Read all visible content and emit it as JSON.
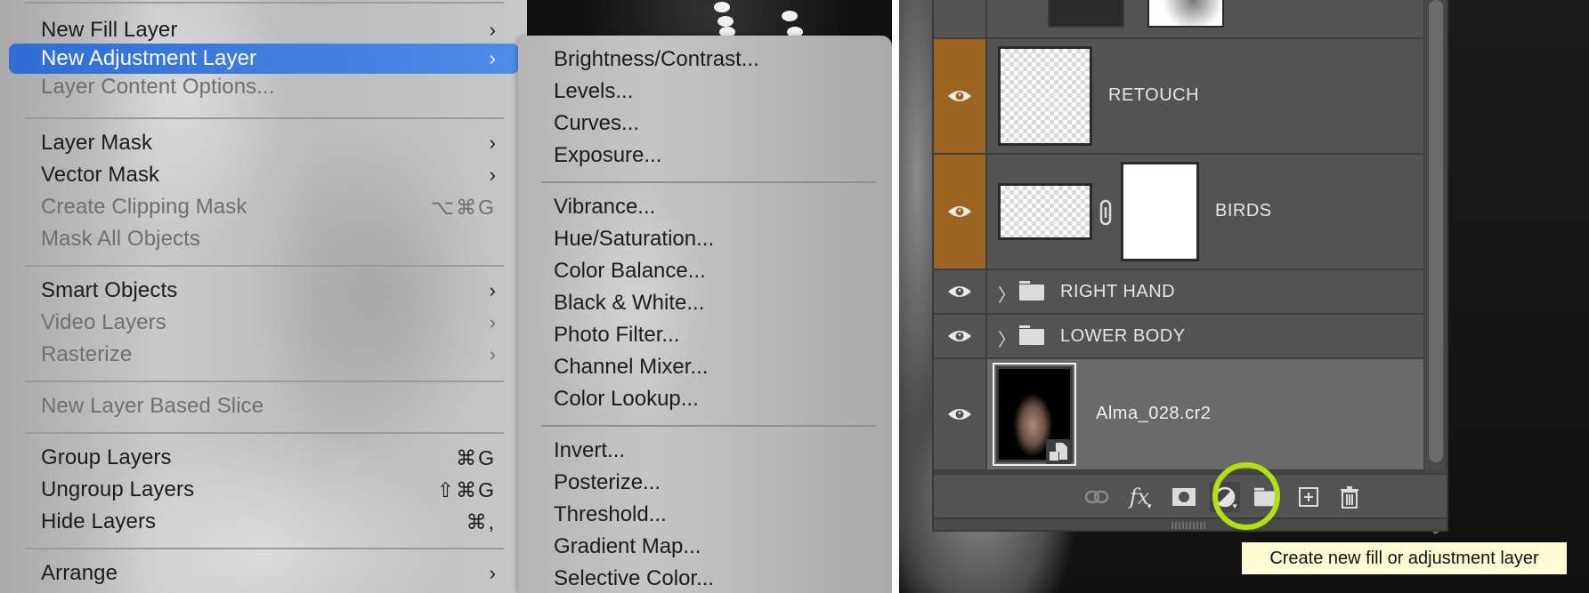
{
  "layer_menu": {
    "items": [
      {
        "label": "New Fill Layer",
        "state": "enabled",
        "submenu": true,
        "shortcut": ""
      },
      {
        "label": "New Adjustment Layer",
        "state": "highlighted",
        "submenu": true,
        "shortcut": ""
      },
      {
        "label": "Layer Content Options...",
        "state": "disabled",
        "submenu": false,
        "shortcut": ""
      },
      {
        "label": "Layer Mask",
        "state": "enabled",
        "submenu": true,
        "shortcut": ""
      },
      {
        "label": "Vector Mask",
        "state": "enabled",
        "submenu": true,
        "shortcut": ""
      },
      {
        "label": "Create Clipping Mask",
        "state": "disabled",
        "submenu": false,
        "shortcut": "⌥⌘G"
      },
      {
        "label": "Mask All Objects",
        "state": "disabled",
        "submenu": false,
        "shortcut": ""
      },
      {
        "label": "Smart Objects",
        "state": "enabled",
        "submenu": true,
        "shortcut": ""
      },
      {
        "label": "Video Layers",
        "state": "disabled",
        "submenu": true,
        "shortcut": ""
      },
      {
        "label": "Rasterize",
        "state": "disabled",
        "submenu": true,
        "shortcut": ""
      },
      {
        "label": "New Layer Based Slice",
        "state": "disabled",
        "submenu": false,
        "shortcut": ""
      },
      {
        "label": "Group Layers",
        "state": "enabled",
        "submenu": false,
        "shortcut": "⌘G"
      },
      {
        "label": "Ungroup Layers",
        "state": "enabled",
        "submenu": false,
        "shortcut": "⇧⌘G"
      },
      {
        "label": "Hide Layers",
        "state": "enabled",
        "submenu": false,
        "shortcut": "⌘,"
      },
      {
        "label": "Arrange",
        "state": "enabled",
        "submenu": true,
        "shortcut": ""
      }
    ],
    "chevron": "›"
  },
  "adjustment_submenu": {
    "items": [
      "Brightness/Contrast...",
      "Levels...",
      "Curves...",
      "Exposure...",
      "Vibrance...",
      "Hue/Saturation...",
      "Color Balance...",
      "Black & White...",
      "Photo Filter...",
      "Channel Mixer...",
      "Color Lookup...",
      "Invert...",
      "Posterize...",
      "Threshold...",
      "Gradient Map...",
      "Selective Color..."
    ]
  },
  "layers_panel": {
    "layers": [
      {
        "name": "RETOUCH",
        "type": "pixel",
        "visible": true,
        "color_label": "orange"
      },
      {
        "name": "BIRDS",
        "type": "pixel-with-mask",
        "visible": true,
        "color_label": "orange",
        "mask_linked": true
      },
      {
        "name": "RIGHT HAND",
        "type": "group",
        "visible": true,
        "expanded": false
      },
      {
        "name": "LOWER BODY",
        "type": "group",
        "visible": true,
        "expanded": false
      },
      {
        "name": "Alma_028.cr2",
        "type": "smart-object",
        "visible": true,
        "selected": true
      }
    ],
    "footer_buttons": [
      {
        "name": "link-layers",
        "icon": "link-icon"
      },
      {
        "name": "add-layer-style",
        "icon": "fx-icon",
        "text": "fx"
      },
      {
        "name": "add-layer-mask",
        "icon": "mask-icon"
      },
      {
        "name": "create-fill-adjustment-layer",
        "icon": "adjustment-icon",
        "active": true
      },
      {
        "name": "create-group",
        "icon": "folder-icon"
      },
      {
        "name": "create-new-layer",
        "icon": "new-layer-icon"
      },
      {
        "name": "delete-layer",
        "icon": "trash-icon"
      }
    ],
    "tooltip": "Create new fill or adjustment layer"
  },
  "colors": {
    "menu_highlight": "#3a78e0",
    "layer_color_label": "#9c6421",
    "annotation_ring": "#b5e00f",
    "tooltip_bg": "#fefdd4",
    "panel_bg": "#535353"
  }
}
